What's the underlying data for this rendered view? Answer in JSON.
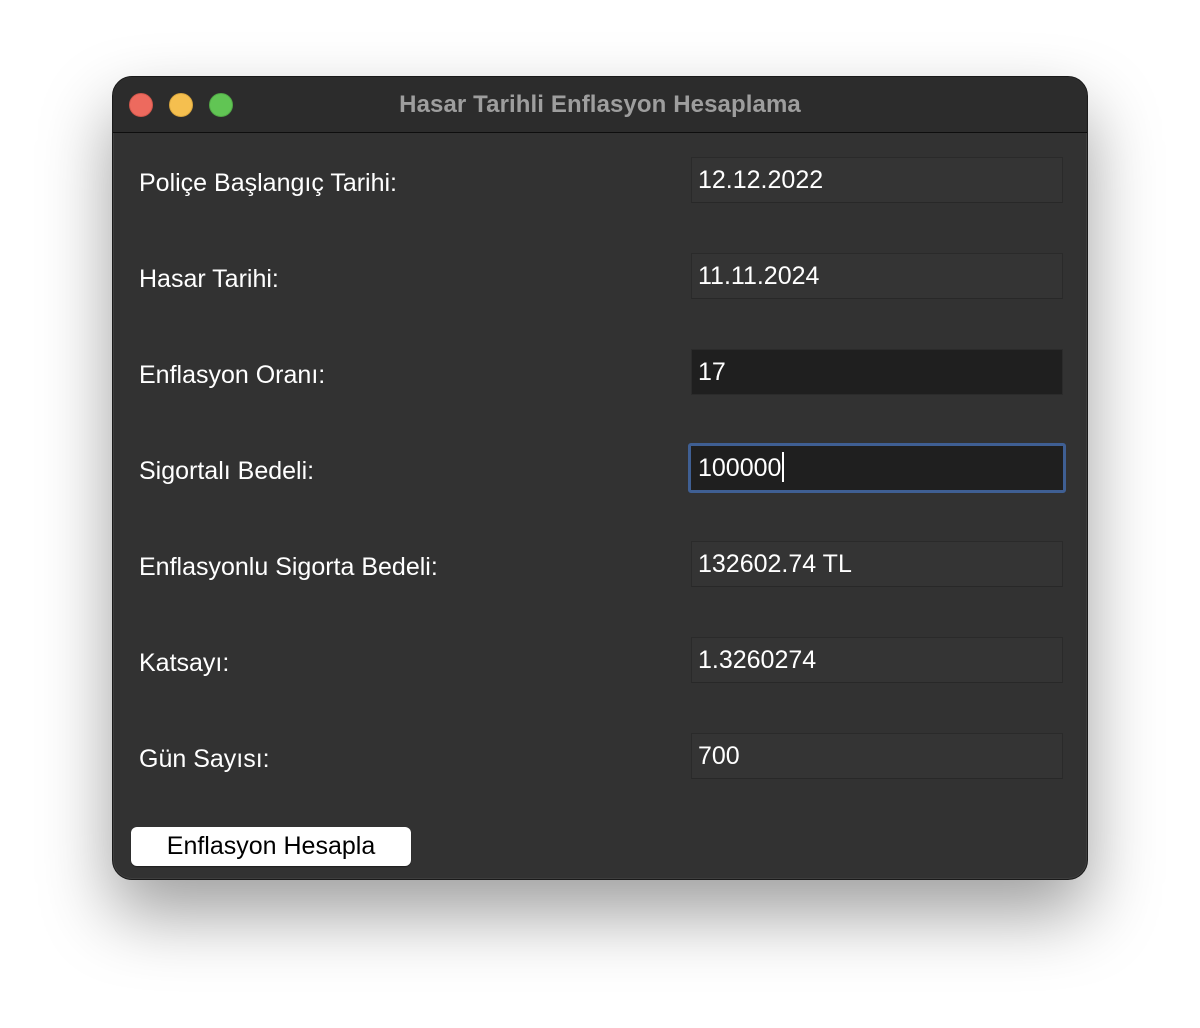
{
  "window": {
    "title": "Hasar Tarihli Enflasyon Hesaplama"
  },
  "form": {
    "police_baslangic": {
      "label": "Poliçe Başlangıç Tarihi:",
      "value": "12.12.2022"
    },
    "hasar_tarihi": {
      "label": "Hasar Tarihi:",
      "value": "11.11.2024"
    },
    "enflasyon_orani": {
      "label": "Enflasyon Oranı:",
      "value": "17"
    },
    "sigortali_bedeli": {
      "label": "Sigortalı Bedeli:",
      "value": "100000"
    },
    "enflasyonlu_bedel": {
      "label": "Enflasyonlu Sigorta Bedeli:",
      "value": "132602.74 TL"
    },
    "katsayi": {
      "label": "Katsayı:",
      "value": "1.3260274"
    },
    "gun_sayisi": {
      "label": "Gün Sayısı:",
      "value": "700"
    }
  },
  "actions": {
    "calculate_label": "Enflasyon Hesapla"
  },
  "colors": {
    "window_bg": "#323232",
    "focus_ring": "#3f5f93",
    "close": "#ed6a5e",
    "minimize": "#f5bf4f",
    "zoom": "#61c554"
  }
}
